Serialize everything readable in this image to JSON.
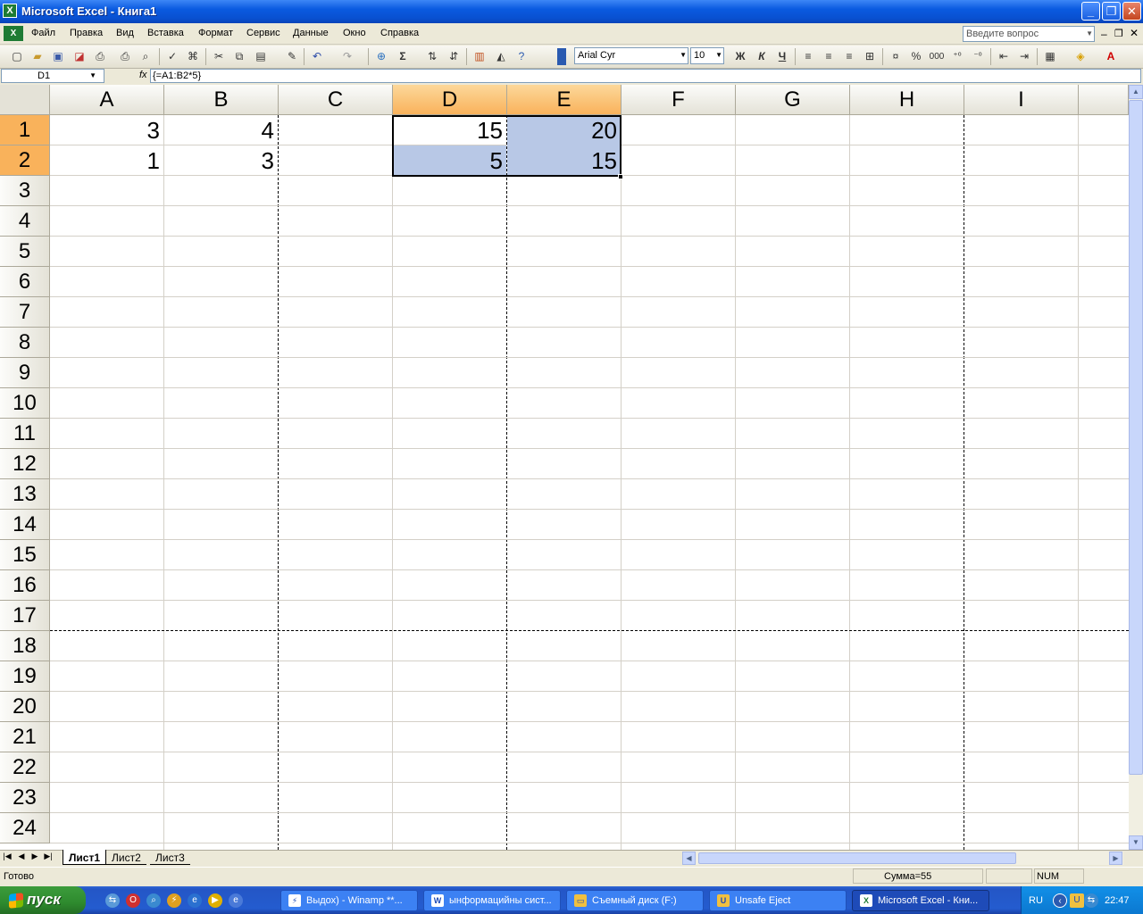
{
  "window": {
    "title": "Microsoft Excel - Книга1",
    "app_icon": "X"
  },
  "menu": [
    "Файл",
    "Правка",
    "Вид",
    "Вставка",
    "Формат",
    "Сервис",
    "Данные",
    "Окно",
    "Справка"
  ],
  "ask": {
    "placeholder": "Введите вопрос"
  },
  "toolbar": {
    "font": "Arial Cyr",
    "size": "10",
    "bold": "Ж",
    "italic": "К",
    "underline": "Ч",
    "sigma": "Σ",
    "percent": "%",
    "thousands": "000"
  },
  "formula_bar": {
    "name_box": "D1",
    "fx": "fx",
    "formula": "{=A1:B2*5}"
  },
  "columns": [
    "A",
    "B",
    "C",
    "D",
    "E",
    "F",
    "G",
    "H",
    "I"
  ],
  "rows": [
    "1",
    "2",
    "3",
    "4",
    "5",
    "6",
    "7",
    "8",
    "9",
    "10",
    "11",
    "12",
    "13",
    "14",
    "15",
    "16",
    "17",
    "18",
    "19",
    "20",
    "21",
    "22",
    "23",
    "24"
  ],
  "cells": {
    "A1": "3",
    "B1": "4",
    "A2": "1",
    "B2": "3",
    "D1": "15",
    "E1": "20",
    "D2": "5",
    "E2": "15"
  },
  "sheets": [
    "Лист1",
    "Лист2",
    "Лист3"
  ],
  "status": {
    "ready": "Готово",
    "sum": "Сумма=55",
    "num": "NUM"
  },
  "taskbar": {
    "start": "пуск",
    "tasks": [
      "Выдох) - Winamp **...",
      "ынформацийны сист...",
      "Съемный диск (F:)",
      "Unsafe Eject",
      "Microsoft Excel - Кни..."
    ],
    "lang": "RU",
    "clock": "22:47"
  },
  "colors": {
    "selection_header": "#f9b25b",
    "selection_fill": "#b8c8e6",
    "titlebar": "#0a5ae0",
    "taskbar": "#245ccf",
    "start": "#2e8a2e"
  }
}
